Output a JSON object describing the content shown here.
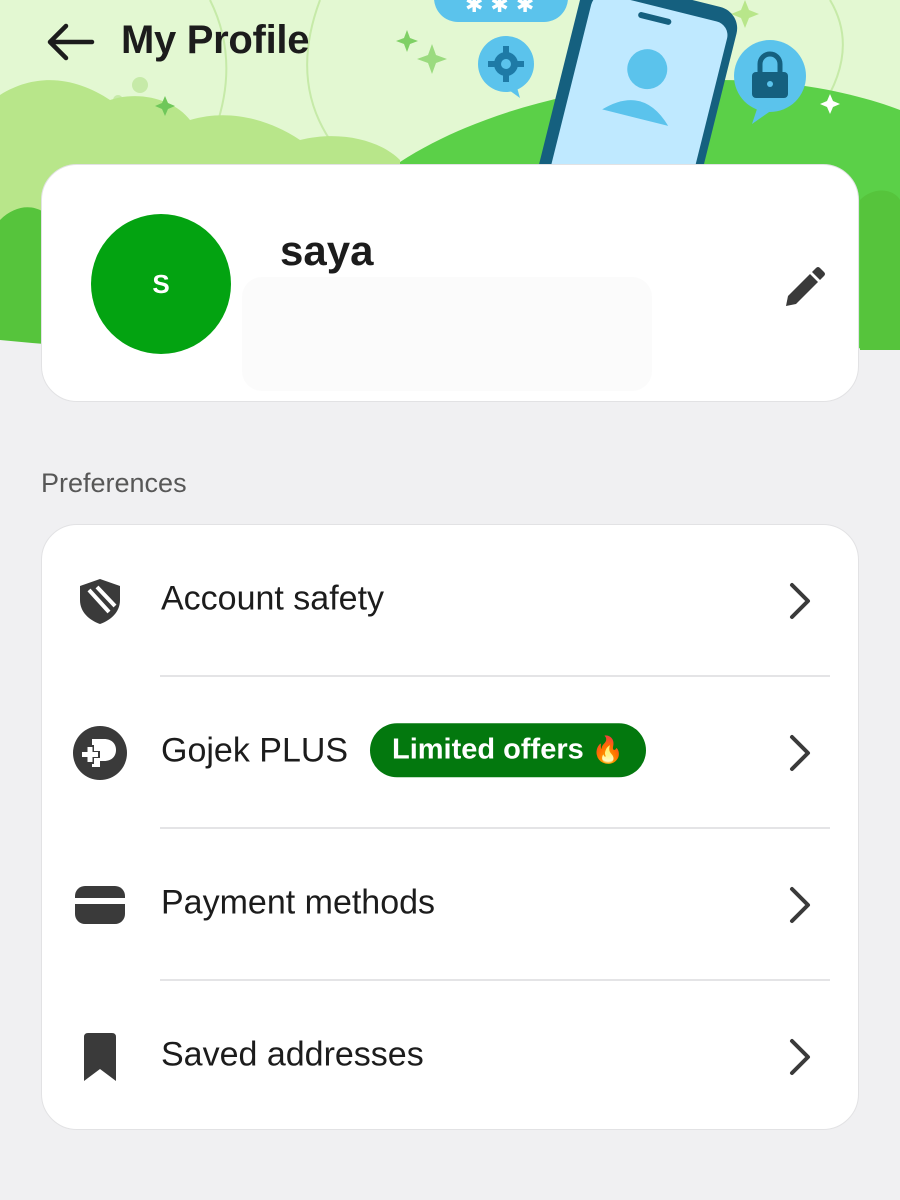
{
  "header": {
    "title": "My Profile",
    "back_icon": "arrow-left-icon"
  },
  "profile": {
    "avatar_initial": "S",
    "name": "saya",
    "edit_icon": "pencil-icon"
  },
  "preferences": {
    "section_title": "Preferences",
    "items": [
      {
        "label": "Account safety",
        "icon": "shield-icon"
      },
      {
        "label": "Gojek PLUS",
        "icon": "gojek-plus-icon",
        "badge": "Limited offers",
        "badge_emoji": "🔥"
      },
      {
        "label": "Payment methods",
        "icon": "card-icon"
      },
      {
        "label": "Saved addresses",
        "icon": "bookmark-icon"
      }
    ]
  },
  "colors": {
    "avatar": "#03a311",
    "badge": "#03780e",
    "header_light_green": "#def7cc",
    "header_mid_green": "#9bdb5a",
    "header_dark_green": "#5ad04a",
    "phone_body": "#1e7aa6",
    "phone_screen": "#bfe9ff",
    "bubble": "#5bc3ec"
  }
}
